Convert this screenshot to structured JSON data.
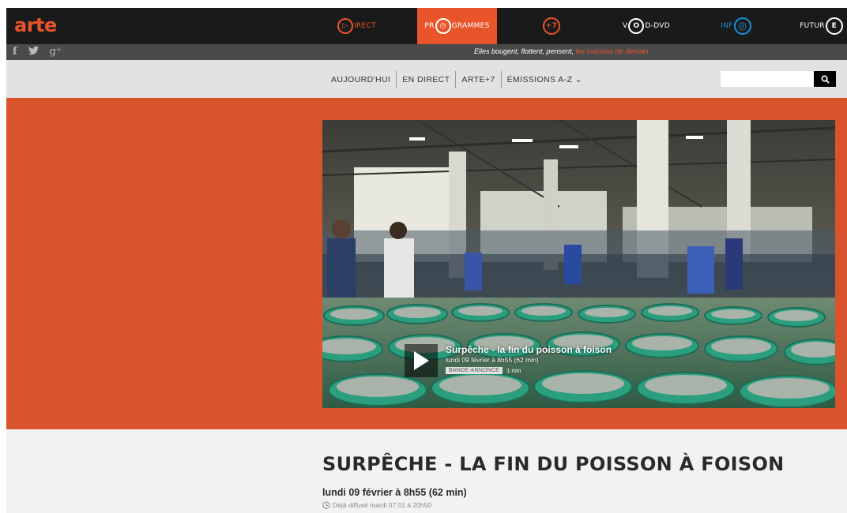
{
  "brand": {
    "logo": "arte",
    "accent": "#e8552a"
  },
  "nav": {
    "direct": {
      "pre": "",
      "ring": "▷",
      "post": "IRECT"
    },
    "programmes": {
      "pre": "PR",
      "ring": "◷",
      "post": "GRAMMES"
    },
    "plus7": {
      "pre": "",
      "ring": "+7",
      "post": ""
    },
    "vod": {
      "pre": "V",
      "ring": "O",
      "post": "D-DVD"
    },
    "info": {
      "pre": "INF",
      "ring": "◎",
      "post": ""
    },
    "future": {
      "pre": "FUTUR",
      "ring": "E",
      "post": ""
    }
  },
  "social": {
    "facebook": "f",
    "twitter": "🐦",
    "gplus": "g⁺"
  },
  "slogan": {
    "text": "Elles bougent, flottent, pensent,",
    "highlight": "les maisons de demain."
  },
  "secnav": {
    "items": [
      "AUJOURD'HUI",
      "EN DIRECT",
      "ARTE+7",
      "ÉMISSIONS A-Z ⌄"
    ]
  },
  "search": {
    "placeholder": ""
  },
  "player": {
    "title": "Surpêche - la fin du poisson à foison",
    "date": "lundi 09 février à 8h55 (62 min)",
    "badge": "BANDE-ANNONCE",
    "duration": "1 min"
  },
  "program": {
    "title": "SURPÊCHE - LA FIN DU POISSON À FOISON",
    "date": "lundi 09 février à 8h55 (62 min)",
    "rerun": "Déjà diffusé mardi 07.01 à 20h50"
  }
}
